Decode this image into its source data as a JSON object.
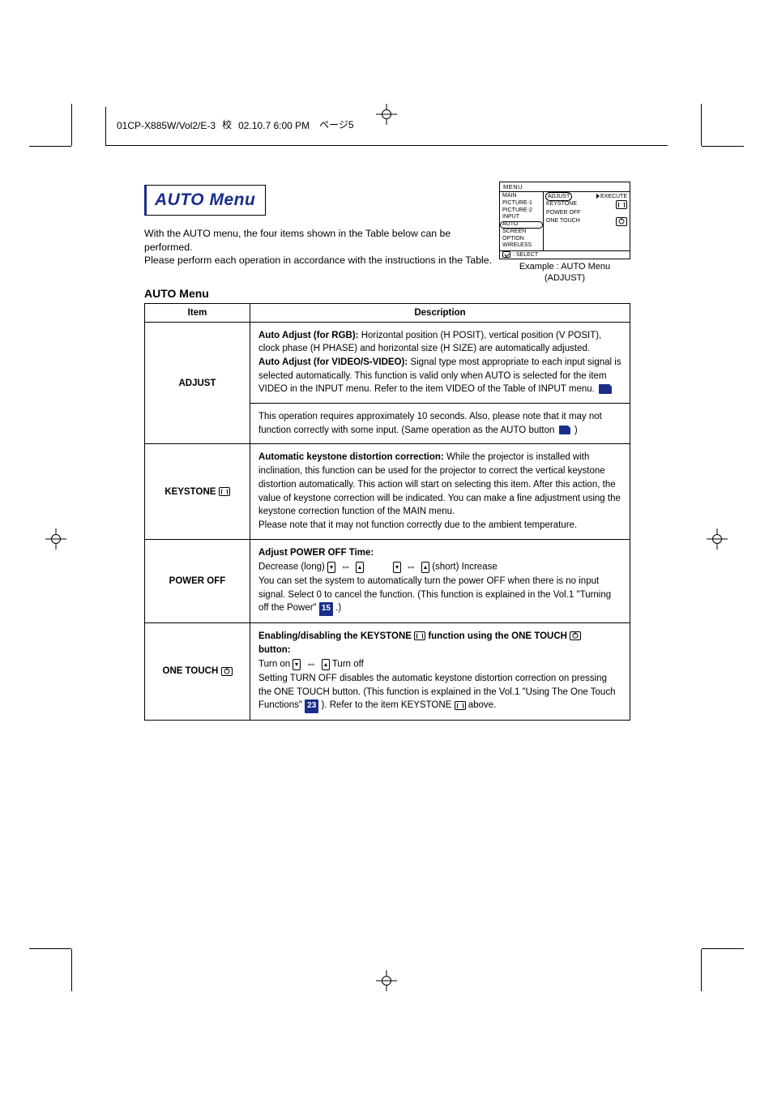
{
  "header": {
    "doc_code": "01CP-X885W/Vol2/E-3",
    "kanji": "校",
    "timestamp": "02.10.7 6:00 PM",
    "page_marker": "ページ5"
  },
  "title": "AUTO Menu",
  "intro_line1": "With the AUTO menu, the four items shown in the Table below can be performed.",
  "intro_line2": "Please perform each operation in accordance with the instructions in the Table.",
  "osd": {
    "menu_label": "MENU",
    "left_items": [
      "MAIN",
      "PICTURE-1",
      "PICTURE-2",
      "INPUT",
      "AUTO",
      "SCREEN",
      "OPTION",
      "WIRELESS"
    ],
    "right_items": [
      "ADJUST",
      "KEYSTONE",
      "POWER OFF",
      "ONE TOUCH"
    ],
    "execute": "EXECUTE",
    "footer": ": SELECT",
    "caption_line1": "Example : AUTO Menu",
    "caption_line2": "(ADJUST)"
  },
  "table_heading": "AUTO Menu",
  "table": {
    "col_item": "Item",
    "col_desc": "Description",
    "rows": [
      {
        "item": "ADJUST",
        "heading1": "Auto Adjust (for RGB):",
        "body1": "Horizontal position (H POSIT), vertical position (V POSIT), clock phase (H PHASE) and horizontal size (H SIZE) are automatically adjusted.",
        "heading2": "Auto Adjust (for VIDEO/S-VIDEO):",
        "body2": "Signal type most appropriate to each input signal is selected automatically. This function is valid only when AUTO is selected for the item VIDEO in the INPUT menu. Refer to the item VIDEO of the Table of INPUT menu.",
        "note": "This operation requires approximately 10 seconds. Also, please note that it may not function correctly with some input. (Same operation as the AUTO button"
      },
      {
        "item": "KEYSTONE",
        "heading": "Automatic keystone distortion correction:",
        "body": "While the projector is installed with inclination, this function can be used for the projector to correct the vertical keystone distortion automatically. This action will start on selecting this item. After this action, the value of keystone correction will be indicated. You can make a fine adjustment using the keystone correction function of the MAIN menu.",
        "body2": "Please note that it may not function correctly due to the ambient temperature."
      },
      {
        "item": "POWER OFF",
        "heading": "Adjust POWER OFF Time:",
        "decrease_label": "Decrease (long)",
        "increase_label": "(short) Increase",
        "body": "You can set the system to automatically turn the power OFF when there is no input signal. Select 0 to cancel the function. (This function is explained in the Vol.1 \"Turning off the Power\"",
        "page_ref": "15",
        "body_end": ".)"
      },
      {
        "item": "ONE TOUCH",
        "heading_a": "Enabling/disabling the KEYSTONE",
        "heading_b": "function using the ONE TOUCH",
        "heading_c": "button:",
        "turn_on": "Turn on",
        "turn_off": "Turn off",
        "body": "Setting TURN OFF disables the automatic keystone distortion correction on pressing the ONE TOUCH button. (This function is explained in the Vol.1 \"Using The One Touch Functions\"",
        "page_ref": "23",
        "body2": "). Refer to the item KEYSTONE",
        "body3": "above."
      }
    ]
  }
}
